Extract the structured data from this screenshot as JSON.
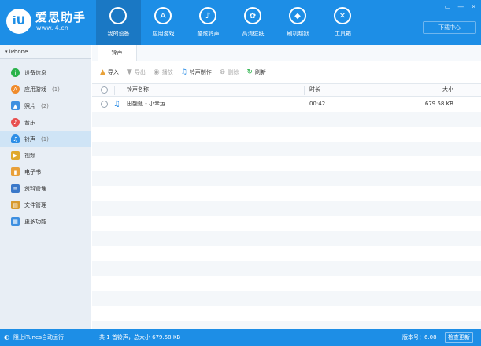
{
  "app": {
    "name": "爱思助手",
    "url": "www.i4.cn",
    "logo_mark": "iU",
    "brand_color": "#1d8ee6"
  },
  "nav": [
    {
      "label": "我的设备",
      "icon": "apple-icon",
      "glyph": ""
    },
    {
      "label": "应用游戏",
      "icon": "app-store-icon",
      "glyph": "A"
    },
    {
      "label": "酷炫铃声",
      "icon": "bell-icon",
      "glyph": "♪"
    },
    {
      "label": "高清壁纸",
      "icon": "flower-icon",
      "glyph": "✿"
    },
    {
      "label": "刷机越狱",
      "icon": "dropbox-icon",
      "glyph": "◆"
    },
    {
      "label": "工具箱",
      "icon": "tools-icon",
      "glyph": "✕"
    }
  ],
  "window": {
    "download_center": "下载中心"
  },
  "sidebar": {
    "device": "iPhone",
    "items": [
      {
        "label": "设备信息",
        "count": "",
        "icon": "info-icon",
        "color": "#2ab24a"
      },
      {
        "label": "应用游戏",
        "count": "(1)",
        "icon": "app-icon",
        "color": "#f08b2b"
      },
      {
        "label": "照片",
        "count": "(2)",
        "icon": "photo-icon",
        "color": "#3d8fe0"
      },
      {
        "label": "音乐",
        "count": "",
        "icon": "music-icon",
        "color": "#e85050"
      },
      {
        "label": "铃声",
        "count": "(1)",
        "icon": "bell-icon",
        "color": "#2d8ee6"
      },
      {
        "label": "视频",
        "count": "",
        "icon": "video-icon",
        "color": "#e0a82a"
      },
      {
        "label": "电子书",
        "count": "",
        "icon": "book-icon",
        "color": "#e8a03a"
      },
      {
        "label": "资料管理",
        "count": "",
        "icon": "contacts-icon",
        "color": "#3a78c9"
      },
      {
        "label": "文件管理",
        "count": "",
        "icon": "file-icon",
        "color": "#d79a2e"
      },
      {
        "label": "更多功能",
        "count": "",
        "icon": "grid-icon",
        "color": "#3d8fe0"
      }
    ]
  },
  "main": {
    "tab": "铃声",
    "toolbar": {
      "import": "导入",
      "export": "导出",
      "play": "播放",
      "make": "铃声制作",
      "delete": "删除",
      "refresh": "刷新"
    },
    "columns": {
      "name": "铃声名称",
      "duration": "时长",
      "size": "大小"
    },
    "rows": [
      {
        "name": "田馥甄 - 小幸运",
        "duration": "00:42",
        "size": "679.58 KB"
      }
    ]
  },
  "status": {
    "itunes": "阻止iTunes自动运行",
    "summary": "共 1 首铃声，总大小 679.58 KB",
    "version": "版本号：6.08",
    "update": "检查更新"
  }
}
